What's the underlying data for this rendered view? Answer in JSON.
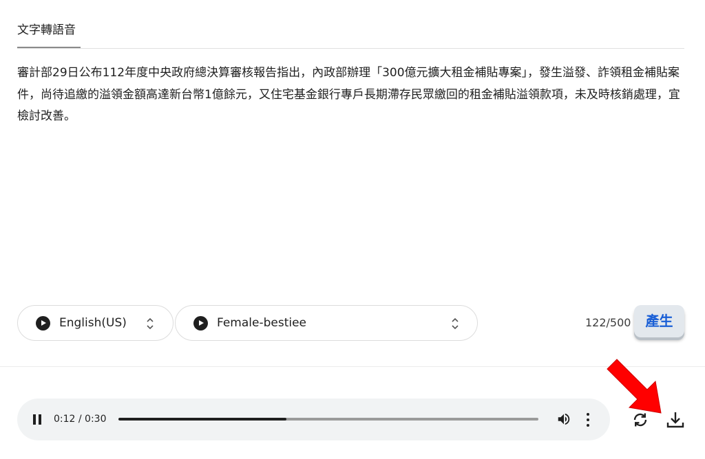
{
  "tabs": [
    {
      "label": "文字轉語音",
      "active": true
    }
  ],
  "editor": {
    "text": "審計部29日公布112年度中央政府總決算審核報告指出，內政部辦理「300億元擴大租金補貼專案」，發生溢發、詐領租金補貼案件，尚待追繳的溢領金額高達新台幣1億餘元，又住宅基金銀行專戶長期滯存民眾繳回的租金補貼溢領款項，未及時核銷處理，宜檢討改善。"
  },
  "controls": {
    "language_select": {
      "value": "English(US)",
      "icon": "play-icon"
    },
    "voice_select": {
      "value": "Female-bestiee",
      "icon": "play-icon"
    },
    "char_count": "122/500",
    "generate_label": "產生"
  },
  "player": {
    "time": "0:12 / 0:30",
    "progress": 0.4,
    "icons": [
      "pause-icon",
      "volume-icon",
      "more-vert-icon"
    ]
  },
  "actions": {
    "icons": [
      "replay-icon",
      "download-icon"
    ]
  },
  "colors": {
    "accent_blue": "#1a5fd6",
    "button_bg": "#e3e8ed",
    "player_bg": "#f1f3f4",
    "arrow_red": "#ff0000"
  }
}
